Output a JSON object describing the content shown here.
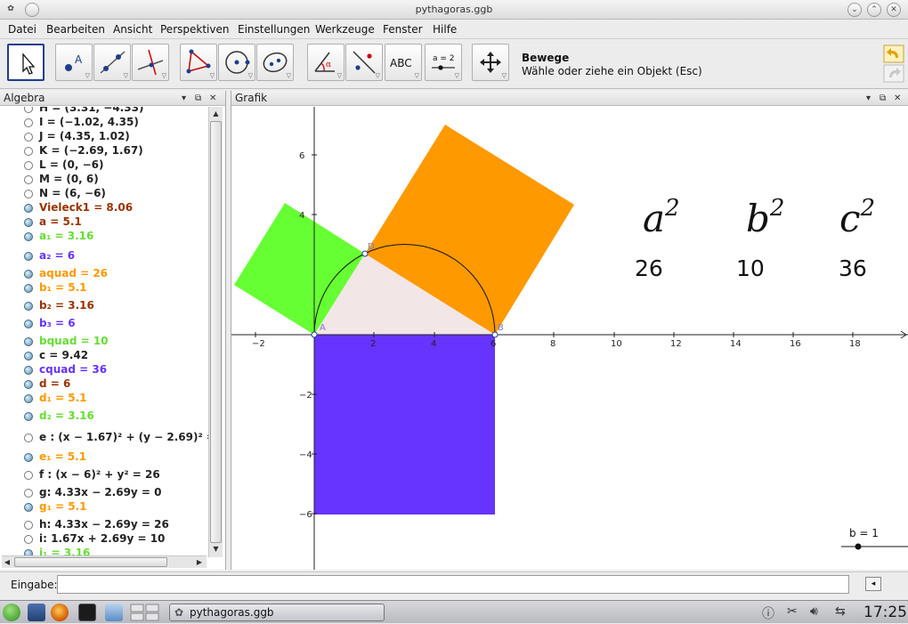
{
  "window": {
    "title": "pythagoras.ggb"
  },
  "menu": [
    "Datei",
    "Bearbeiten",
    "Ansicht",
    "Perspektiven",
    "Einstellungen",
    "Werkzeuge",
    "Fenster",
    "Hilfe"
  ],
  "toolbar": {
    "tool_help_title": "Bewege",
    "tool_help_desc": "Wähle oder ziehe ein Objekt (Esc)",
    "text_tool_label": "ABC",
    "slider_tool_label": "a = 2"
  },
  "algebra": {
    "title": "Algebra",
    "rows": [
      {
        "name": "H",
        "value": "H = (3.31, −4.33)",
        "color": "#222222",
        "filled": false
      },
      {
        "name": "I",
        "value": "I = (−1.02, 4.35)",
        "color": "#222222",
        "filled": false
      },
      {
        "name": "J",
        "value": "J = (4.35, 1.02)",
        "color": "#222222",
        "filled": false
      },
      {
        "name": "K",
        "value": "K = (−2.69, 1.67)",
        "color": "#222222",
        "filled": false
      },
      {
        "name": "L",
        "value": "L = (0, −6)",
        "color": "#222222",
        "filled": false
      },
      {
        "name": "M",
        "value": "M = (0, 6)",
        "color": "#222222",
        "filled": false
      },
      {
        "name": "N",
        "value": "N = (6, −6)",
        "color": "#222222",
        "filled": false
      },
      {
        "name": "Vieleck1",
        "value": "Vieleck1 = 8.06",
        "color": "#993300",
        "filled": true
      },
      {
        "name": "a",
        "value": "a = 5.1",
        "color": "#993300",
        "filled": true
      },
      {
        "name": "a1",
        "value": "a₁ = 3.16",
        "color": "#66dd33",
        "filled": true
      },
      {
        "name": "a2",
        "value": "a₂ = 6",
        "color": "#6633ff",
        "filled": true
      },
      {
        "name": "aquad",
        "value": "aquad = 26",
        "color": "#ff9900",
        "filled": true
      },
      {
        "name": "b1",
        "value": "b₁ = 5.1",
        "color": "#ff9900",
        "filled": true
      },
      {
        "name": "b2",
        "value": "b₂ = 3.16",
        "color": "#993300",
        "filled": true
      },
      {
        "name": "b3",
        "value": "b₃ = 6",
        "color": "#6633ff",
        "filled": true
      },
      {
        "name": "bquad",
        "value": "bquad = 10",
        "color": "#66dd33",
        "filled": true
      },
      {
        "name": "c",
        "value": "c = 9.42",
        "color": "#222222",
        "filled": true
      },
      {
        "name": "cquad",
        "value": "cquad = 36",
        "color": "#6633ff",
        "filled": true
      },
      {
        "name": "d",
        "value": "d = 6",
        "color": "#993300",
        "filled": true
      },
      {
        "name": "d1",
        "value": "d₁ = 5.1",
        "color": "#ff9900",
        "filled": true
      },
      {
        "name": "d2",
        "value": "d₂ = 3.16",
        "color": "#66dd33",
        "filled": true
      },
      {
        "name": "e",
        "value": "e : (x − 1.67)² + (y − 2.69)² =",
        "color": "#222222",
        "filled": false
      },
      {
        "name": "e1",
        "value": "e₁ = 5.1",
        "color": "#ff9900",
        "filled": true
      },
      {
        "name": "f",
        "value": "f : (x − 6)² + y² = 26",
        "color": "#222222",
        "filled": false
      },
      {
        "name": "g",
        "value": "g: 4.33x − 2.69y = 0",
        "color": "#222222",
        "filled": false
      },
      {
        "name": "g1",
        "value": "g₁ = 5.1",
        "color": "#ff9900",
        "filled": true
      },
      {
        "name": "h",
        "value": "h: 4.33x − 2.69y = 26",
        "color": "#222222",
        "filled": false
      },
      {
        "name": "i",
        "value": "i: 1.67x + 2.69y = 10",
        "color": "#222222",
        "filled": false
      },
      {
        "name": "i1",
        "value": "i₁ = 3.16",
        "color": "#66dd33",
        "filled": true
      }
    ]
  },
  "graphics": {
    "title": "Grafik",
    "x_ticks": [
      "−2",
      "2",
      "4",
      "6",
      "8",
      "10",
      "12",
      "14",
      "16",
      "18"
    ],
    "y_ticks": [
      "6",
      "4",
      "−2",
      "−4",
      "−6"
    ],
    "point_labels": {
      "A": "A",
      "B": "B",
      "D": "D"
    },
    "formula_labels": [
      "a",
      "b",
      "c"
    ],
    "formula_exponent": "2",
    "formula_values": [
      "26",
      "10",
      "36"
    ],
    "slider_label": "b = 1",
    "colors": {
      "square_c": "#6633ff",
      "square_a": "#ff9900",
      "square_b": "#66ff33",
      "triangle": "#f2e6e6"
    }
  },
  "input": {
    "label": "Eingabe:",
    "value": ""
  },
  "taskbar": {
    "window_label": "pythagoras.ggb",
    "clock": "17:25"
  }
}
